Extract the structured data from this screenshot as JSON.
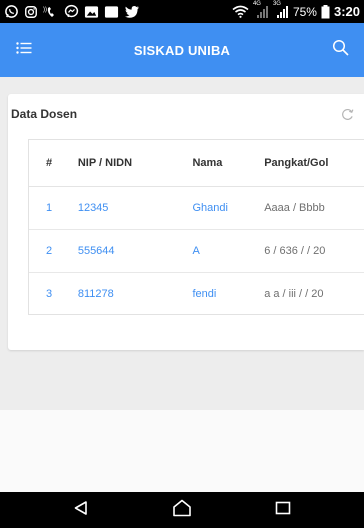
{
  "status_bar": {
    "time": "3:20",
    "battery": "75%",
    "network_4g": "4G",
    "network_3g": "3G",
    "left_icons": [
      "whatsapp-icon",
      "instagram-icon",
      "wifi-calling-icon",
      "messenger-icon",
      "photo-icon",
      "blank-notification-icon",
      "twitter-icon"
    ]
  },
  "app_bar": {
    "title": "SISKAD UNIBA",
    "menu_icon": "list-menu-icon",
    "search_icon": "search-icon",
    "color": "#3f8ff2"
  },
  "card": {
    "title": "Data Dosen",
    "refresh_icon": "refresh-icon"
  },
  "table": {
    "headers": [
      "#",
      "NIP / NIDN",
      "Nama",
      "Pangkat/Gol"
    ],
    "rows": [
      {
        "no": "1",
        "nip": "12345",
        "nama": "Ghandi",
        "pangkat": "Aaaa / Bbbb"
      },
      {
        "no": "2",
        "nip": "555644",
        "nama": "A",
        "pangkat": "6 / 636 / / 20"
      },
      {
        "no": "3",
        "nip": "811278",
        "nama": "fendi",
        "pangkat": "a a / iii / / 20"
      }
    ],
    "link_color": "#3f8ff2"
  },
  "nav_bar": {
    "buttons": [
      "back-icon",
      "home-icon",
      "recents-icon"
    ]
  }
}
